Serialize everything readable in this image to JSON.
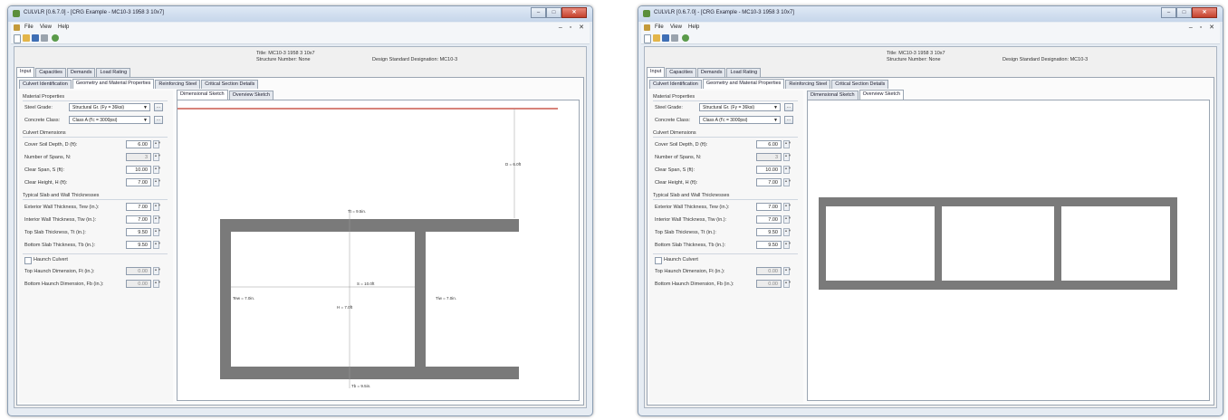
{
  "window": {
    "title": "CULVLR [0.6.7.0] - [CRG Example - MC10-3 1958 3 10x7]",
    "controls": {
      "minimize": "–",
      "maximize": "□",
      "close": "✕"
    },
    "mdi_controls": "– ▫ ✕"
  },
  "menu": {
    "file": "File",
    "view": "View",
    "help": "Help"
  },
  "info": {
    "title": "Title: MC10-3 1958 3 10x7",
    "structure_number": "Structure Number: None",
    "design_standard": "Design Standard Designation: MC10-3"
  },
  "main_tabs": [
    "Input",
    "Capacities",
    "Demands",
    "Load Rating"
  ],
  "sub_tabs": [
    "Culvert Identification",
    "Geometry and Material Properties",
    "Reinforcing Steel",
    "Critical Section Details"
  ],
  "sketch_tabs": [
    "Dimensional Sketch",
    "Overview Sketch"
  ],
  "form": {
    "material_header": "Material Properties",
    "steel_grade_label": "Steel Grade:",
    "steel_grade_value": "Structural Gr. (Fy = 36ksi)",
    "concrete_class_label": "Concrete Class:",
    "concrete_class_value": "Class A (f'c = 3000psi)",
    "browse": "...",
    "dims_header": "Culvert Dimensions",
    "cover_label": "Cover Soil Depth, D (ft):",
    "cover_value": "6.00",
    "spans_label": "Number of Spans, N:",
    "spans_value": "3",
    "span_label": "Clear Span, S (ft):",
    "span_value": "10.00",
    "height_label": "Clear Height, H (ft):",
    "height_value": "7.00",
    "thick_header": "Typical Slab and Wall Thicknesses",
    "tew_label": "Exterior Wall Thickness, Tew (in.):",
    "tew_value": "7.00",
    "tiw_label": "Interior Wall Thickness, Tiw (in.):",
    "tiw_value": "7.00",
    "tt_label": "Top Slab Thickness, Tt (in.):",
    "tt_value": "9.50",
    "tb_label": "Bottom Slab Thickness, Tb (in.):",
    "tb_value": "9.50",
    "haunch_label": "Haunch Culvert",
    "ft_label": "Top Haunch Dimension, Ft (in.):",
    "ft_value": "0.00",
    "fb_label": "Bottom Haunch Dimension, Fb (in.):",
    "fb_value": "0.00"
  },
  "sketch_labels": {
    "d": "D = 6.0ft",
    "tt": "Tt = 9.5in.",
    "s": "S = 10.0ft",
    "h": "H = 7.0ft",
    "tew": "Tew = 7.0in.",
    "tiw": "Tiw = 7.0in.",
    "tb": "Tb = 9.5in."
  },
  "colors": {
    "concrete": "#7a7a7a",
    "ground_line": "#c0392b",
    "accent": "#3a6ea5"
  }
}
